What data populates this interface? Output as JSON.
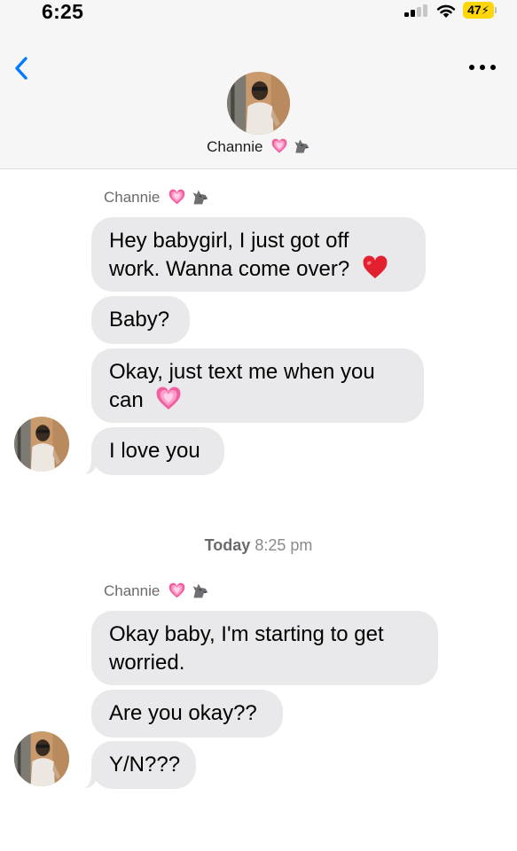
{
  "status_bar": {
    "time": "6:25",
    "battery": "47",
    "signal_bars_active": 2
  },
  "header": {
    "contact_name": "Channie",
    "emoji": [
      "pink-heart",
      "wolf"
    ]
  },
  "groups": [
    {
      "sender": "Channie",
      "messages": [
        {
          "lines": [
            "Hey babygirl, I just got off",
            "work. Wanna come over?"
          ],
          "trailing_emoji": "red-heart"
        },
        {
          "lines": [
            "Baby?"
          ]
        },
        {
          "lines": [
            "Okay, just text me when you",
            "can"
          ],
          "trailing_emoji": "pink-heart"
        },
        {
          "lines": [
            "I love you"
          ]
        }
      ]
    },
    {
      "sender": "Channie",
      "messages": [
        {
          "lines": [
            "Okay baby, I'm starting to get",
            "worried."
          ]
        },
        {
          "lines": [
            "Are you okay??"
          ]
        },
        {
          "lines": [
            "Y/N???"
          ]
        }
      ]
    }
  ],
  "divider": {
    "day": "Today",
    "time": "8:25 pm"
  },
  "colors": {
    "accent_blue": "#007aff",
    "bubble_gray": "#e9e9eb",
    "battery_yellow": "#ffd60a"
  }
}
